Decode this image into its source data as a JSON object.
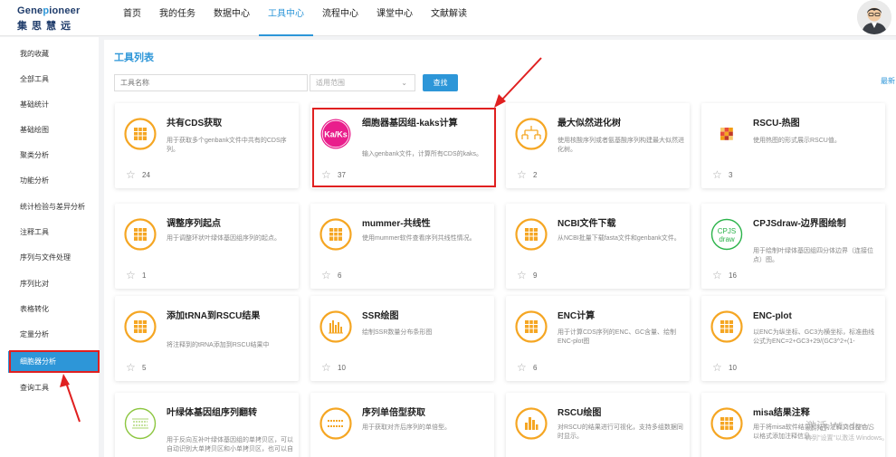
{
  "header": {
    "logo_en_a": "Gene",
    "logo_en_b": "p",
    "logo_en_c": "ioneer",
    "logo_cn": "集思慧远",
    "nav": [
      "首页",
      "我的任务",
      "数据中心",
      "工具中心",
      "流程中心",
      "课堂中心",
      "文献解读"
    ],
    "active_nav": "工具中心"
  },
  "sidebar": {
    "items": [
      "我的收藏",
      "全部工具",
      "基础统计",
      "基础绘图",
      "聚类分析",
      "功能分析",
      "统计检验与差异分析",
      "注释工具",
      "序列与文件处理",
      "序列比对",
      "表格转化",
      "定量分析",
      "细胞器分析",
      "查询工具"
    ],
    "active": "细胞器分析"
  },
  "main": {
    "title": "工具列表",
    "search_placeholder": "工具名称",
    "scope_placeholder": "适用范围",
    "search_button": "查找",
    "latest": "最新",
    "cards": [
      {
        "title": "共有CDS获取",
        "desc": "用于获取多个genbank文件中共有的CDS序列。",
        "count": "24",
        "icon": "table-icon"
      },
      {
        "title": "细胞器基因组-kaks计算",
        "desc": "输入genbank文件，计算所有CDS的kaks。",
        "count": "37",
        "icon": "kaks-icon",
        "icon_text": "Ka/Ks"
      },
      {
        "title": "最大似然进化树",
        "desc": "使用核酸序列或者氨基酸序列构建最大似然进化树。",
        "count": "2",
        "icon": "tree-icon"
      },
      {
        "title": "RSCU-热图",
        "desc": "使用热图的形式展示RSCU值。",
        "count": "3",
        "icon": "heatmap-icon"
      },
      {
        "title": "调整序列起点",
        "desc": "用于调整环状叶绿体基因组序列的起点。",
        "count": "1",
        "icon": "table-icon"
      },
      {
        "title": "mummer-共线性",
        "desc": "使用mummer软件查看序列共线性情况。",
        "count": "6",
        "icon": "table-icon"
      },
      {
        "title": "NCBI文件下载",
        "desc": "从NCBI批量下载fasta文件和genbank文件。",
        "count": "9",
        "icon": "table-icon"
      },
      {
        "title": "CPJSdraw-边界图绘制",
        "desc": "用于绘制叶绿体基因组四分体边界（连接位点）图。",
        "count": "16",
        "icon": "cpjs-icon",
        "icon_text_a": "CPJS",
        "icon_text_b": "draw"
      },
      {
        "title": "添加tRNA到RSCU结果",
        "desc": "将注释到的tRNA添加到RSCU结果中",
        "count": "5",
        "icon": "table-icon"
      },
      {
        "title": "SSR绘图",
        "desc": "绘制SSR数量分布条形图",
        "count": "10",
        "icon": "bar-chart-icon"
      },
      {
        "title": "ENC计算",
        "desc": "用于计算CDS序列的ENC、GC含量、绘制ENC-plot图",
        "count": "6",
        "icon": "table-icon"
      },
      {
        "title": "ENC-plot",
        "desc": "以ENC为纵坐标、GC3为横坐标，标准曲线公式为ENC=2+GC3+29/(GC3^2+(1-GC3)^2)，绘制...",
        "count": "10",
        "icon": "table-icon"
      },
      {
        "title": "叶绿体基因组序列翻转",
        "desc": "用于反向互补叶绿体基因组的单拷贝区，可以自动识别大单拷贝区和小单拷贝区，也可以自定...",
        "count": "",
        "icon": "flip-icon"
      },
      {
        "title": "序列单倍型获取",
        "desc": "用于获取对齐后序列的单倍型。",
        "count": "",
        "icon": "haplotype-icon"
      },
      {
        "title": "RSCU绘图",
        "desc": "对RSCU的结果进行可视化，支持多组数据同时显示。",
        "count": "",
        "icon": "bar-chart-icon"
      },
      {
        "title": "misa结果注释",
        "desc": "用于将misa软件结果和结构注释文件整合，以格式添加注释信息。",
        "count": "",
        "icon": "table-icon"
      }
    ]
  },
  "watermark": {
    "line1": "激活 Windows",
    "line2": "转到\"设置\"以激活 Windows。"
  },
  "colors": {
    "accent": "#2d96d8",
    "icon_orange": "#f5a623",
    "highlight_red": "#e02020",
    "kaks_pink": "#e91e8c"
  }
}
